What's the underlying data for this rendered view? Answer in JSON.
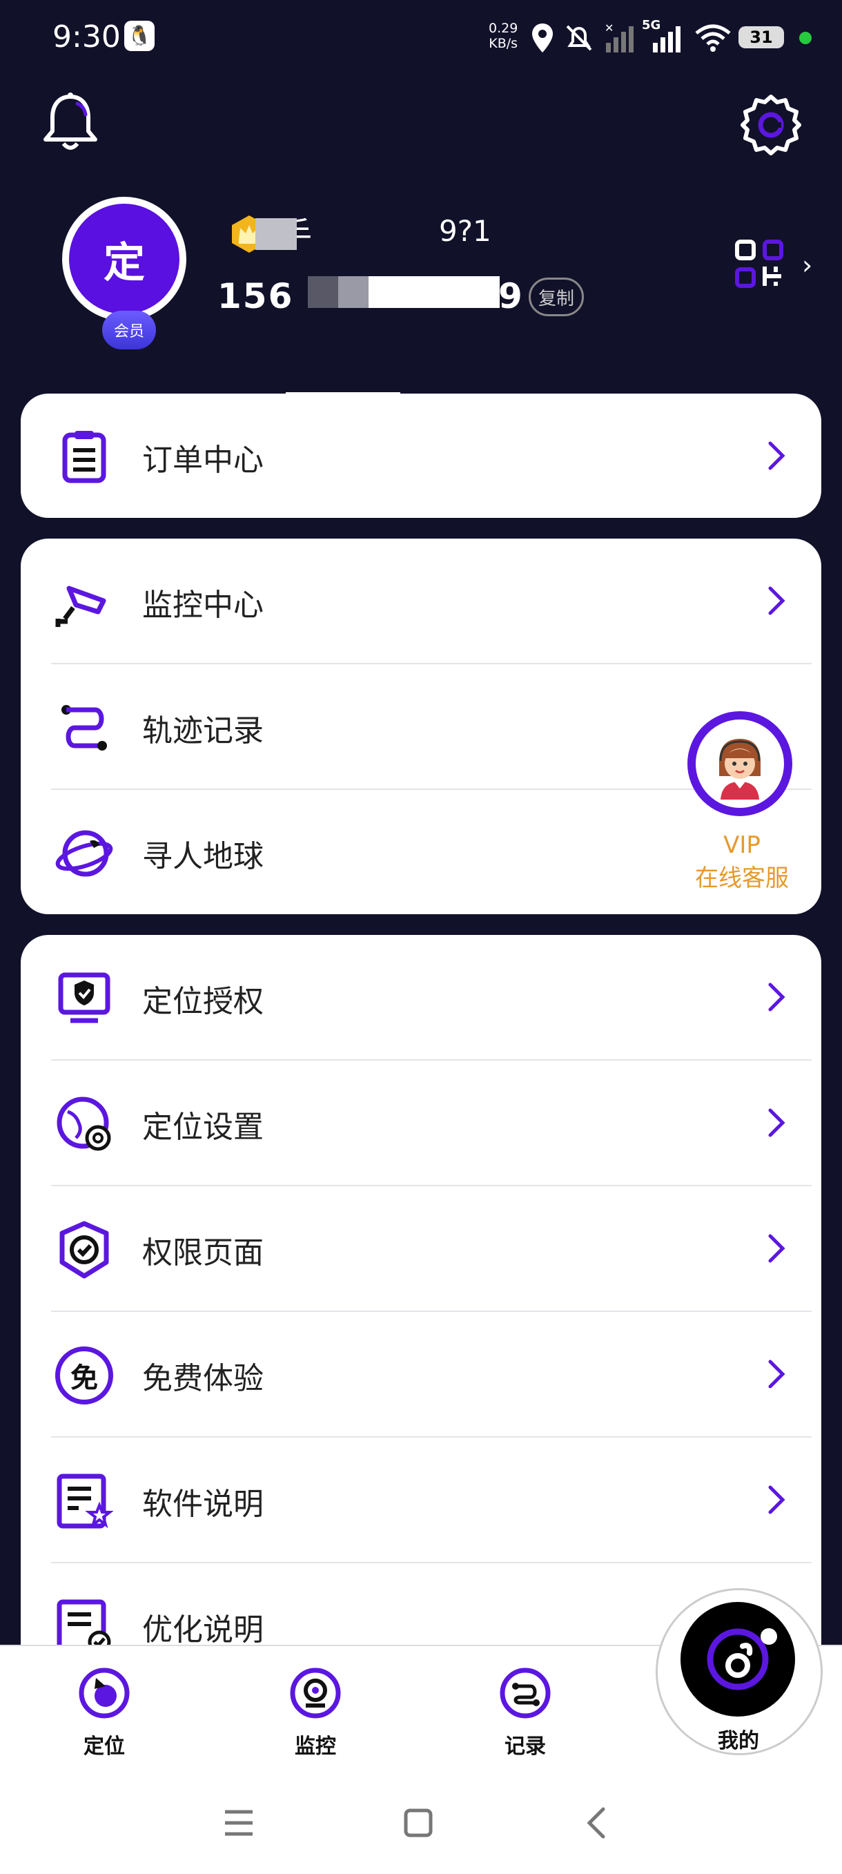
{
  "status_bar": {
    "time": "9:30",
    "net_speed_value": "0.29",
    "net_speed_unit": "KB/s",
    "signal_label": "5G",
    "battery": "31"
  },
  "profile": {
    "avatar_text": "定",
    "member_badge": "会员",
    "username": "手",
    "uid": "9?1",
    "phone_prefix": "156",
    "phone_suffix": "9",
    "copy_label": "复制"
  },
  "menu_group_1": [
    {
      "label": "订单中心",
      "icon": "clipboard-icon"
    }
  ],
  "menu_group_2": [
    {
      "label": "监控中心",
      "icon": "camera-icon"
    },
    {
      "label": "轨迹记录",
      "icon": "route-icon"
    },
    {
      "label": "寻人地球",
      "icon": "globe-icon"
    }
  ],
  "menu_group_3": [
    {
      "label": "定位授权",
      "icon": "shield-monitor-icon"
    },
    {
      "label": "定位设置",
      "icon": "globe-gear-icon"
    },
    {
      "label": "权限页面",
      "icon": "check-badge-icon"
    },
    {
      "label": "免费体验",
      "icon": "free-icon",
      "icon_text": "免"
    },
    {
      "label": "软件说明",
      "icon": "doc-star-icon"
    },
    {
      "label": "优化说明",
      "icon": "doc-check-icon"
    }
  ],
  "vip": {
    "line1": "VIP",
    "line2": "在线客服"
  },
  "bottom_nav": [
    {
      "label": "定位",
      "icon": "location-icon"
    },
    {
      "label": "监控",
      "icon": "monitor-icon"
    },
    {
      "label": "记录",
      "icon": "record-icon"
    },
    {
      "label": "我的",
      "icon": "me-icon"
    }
  ],
  "colors": {
    "accent": "#5b17e0",
    "header_bg": "#12112a",
    "vip_text": "#e59a2e"
  }
}
